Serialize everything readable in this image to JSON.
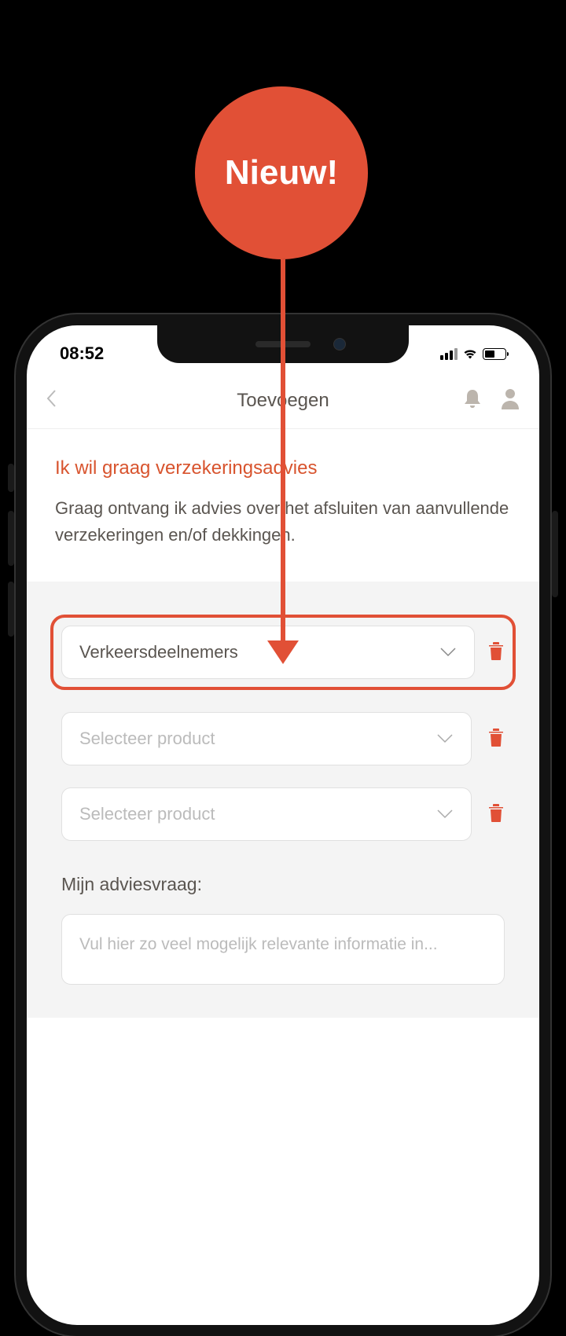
{
  "callout": {
    "text": "Nieuw!"
  },
  "status": {
    "time": "08:52"
  },
  "header": {
    "title": "Toevoegen"
  },
  "content": {
    "heading": "Ik wil graag verzekeringsadvies",
    "description": "Graag ontvang ik advies over het afsluiten van aanvullende verzekeringen en/of dekkingen."
  },
  "form": {
    "dropdown1_value": "Verkeersdeelnemers",
    "dropdown2_placeholder": "Selecteer product",
    "dropdown3_placeholder": "Selecteer product",
    "textarea_label": "Mijn adviesvraag:",
    "textarea_placeholder": "Vul hier zo veel mogelijk relevante informatie in..."
  }
}
